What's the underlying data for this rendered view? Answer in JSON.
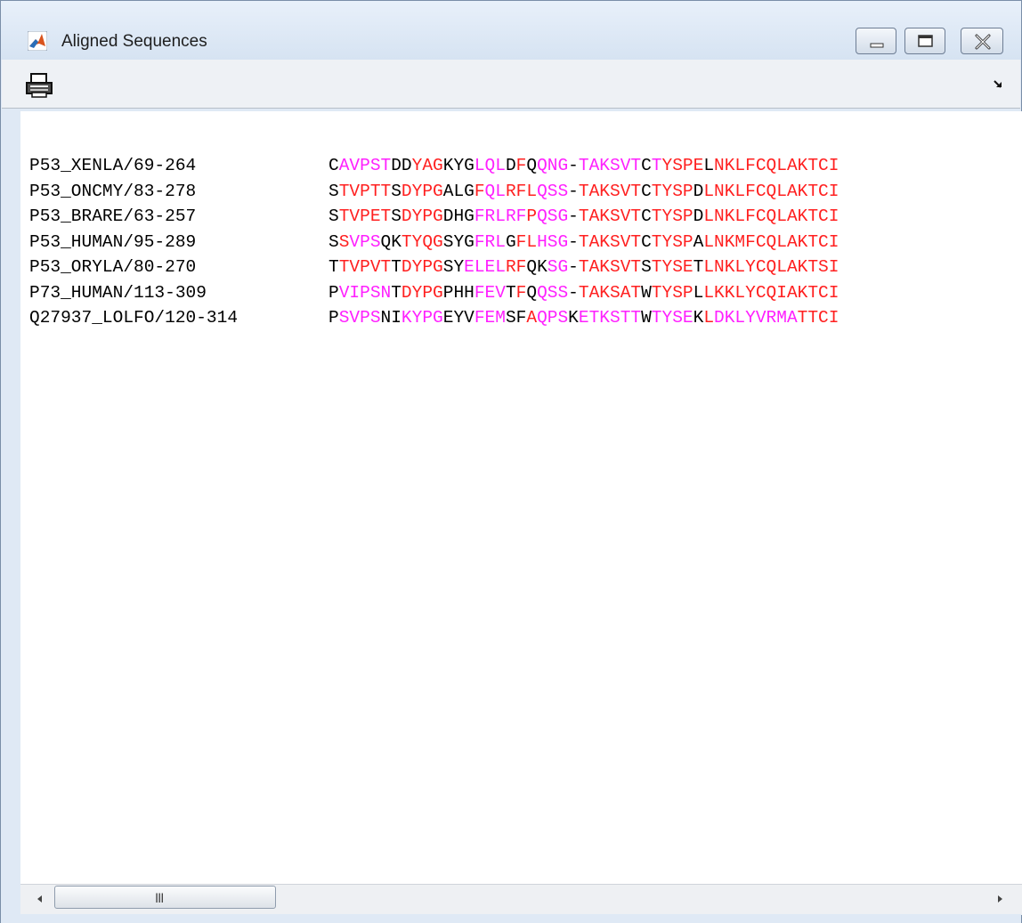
{
  "window": {
    "title": "Aligned Sequences",
    "controls": [
      "minimize",
      "maximize",
      "close"
    ],
    "icon": "matlab-icon"
  },
  "toolbar": {
    "items": [
      "print-icon",
      "dock-icon"
    ]
  },
  "colors": {
    "black": "#000000",
    "red": "#ff2020",
    "magenta": "#ff20ff"
  },
  "sequences": [
    {
      "name": "P53_XENLA/69-264",
      "residues": "CAVPSTDDYAGKYGLQLDFQQNG-TAKSVTCTYSPELNKLFCQLAKTCI",
      "colors": "kmmmmmkkrrrkkkmmmkrkmmmkmmmmmmkmrrrrkrrrrrrrrrrrr"
    },
    {
      "name": "P53_ONCMY/83-278",
      "residues": "STVPTTSDYPGALGFQLRFLQSS-TAKSVTCTYSPDLNKLFCQLAKTCI",
      "colors": "krrrrrkrrrrkkkrmmrrrmmmkrrrrrrkrrrrkrrrrrrrrrrrrr"
    },
    {
      "name": "P53_BRARE/63-257",
      "residues": "STVPETSDYPGDHGFRLRFPQSG-TAKSVTCTYSPDLNKLFCQLAKTCI",
      "colors": "krrrrrkrrrrkkkmmmmmrmmmkrrrrrrkrrrrkrrrrrrrrrrrrr"
    },
    {
      "name": "P53_HUMAN/95-289",
      "residues": "SSVPSQKTYQGSYGFRLGFLHSG-TAKSVTCTYSPALNKMFCQLAKTCI",
      "colors": "krmmmkkrrrrkkkmmmkrrmmmkrrrrrrkrrrrkrrrrrrrrrrrrr"
    },
    {
      "name": "P53_ORYLA/80-270",
      "residues": "TTVPVTTDYPGSYELELRFQKSG-TAKSVTSTYSETLNKLYCQLAKTSI",
      "colors": "krrrrrkrrrrkkmmmmrrkkmmkrrrrrrkrrrrkrrrrrrrrrrrrr"
    },
    {
      "name": "P73_HUMAN/113-309",
      "residues": "PVIPSNTDYPGPHHFEVTFQQSS-TAKSATWTYSPLLKKLYCQIAKTCI",
      "colors": "kmmmmmkrrrrkkkmmmkrkmmmkrrrrrrkrrrrkrrrrrrrrrrrrr"
    },
    {
      "name": "Q27937_LOLFO/120-314",
      "residues": "PSVPSNIKYPGEYVFEMSFAQPSKETKSTTWTYSEKLDKLYVRMATTCI",
      "colors": "kmmmmkkmmmmkkkmmmkkrmmmkmmmmmmkmmmmkrmmmmmmmmrrrr"
    }
  ],
  "scrollbar": {
    "grip": "III"
  }
}
